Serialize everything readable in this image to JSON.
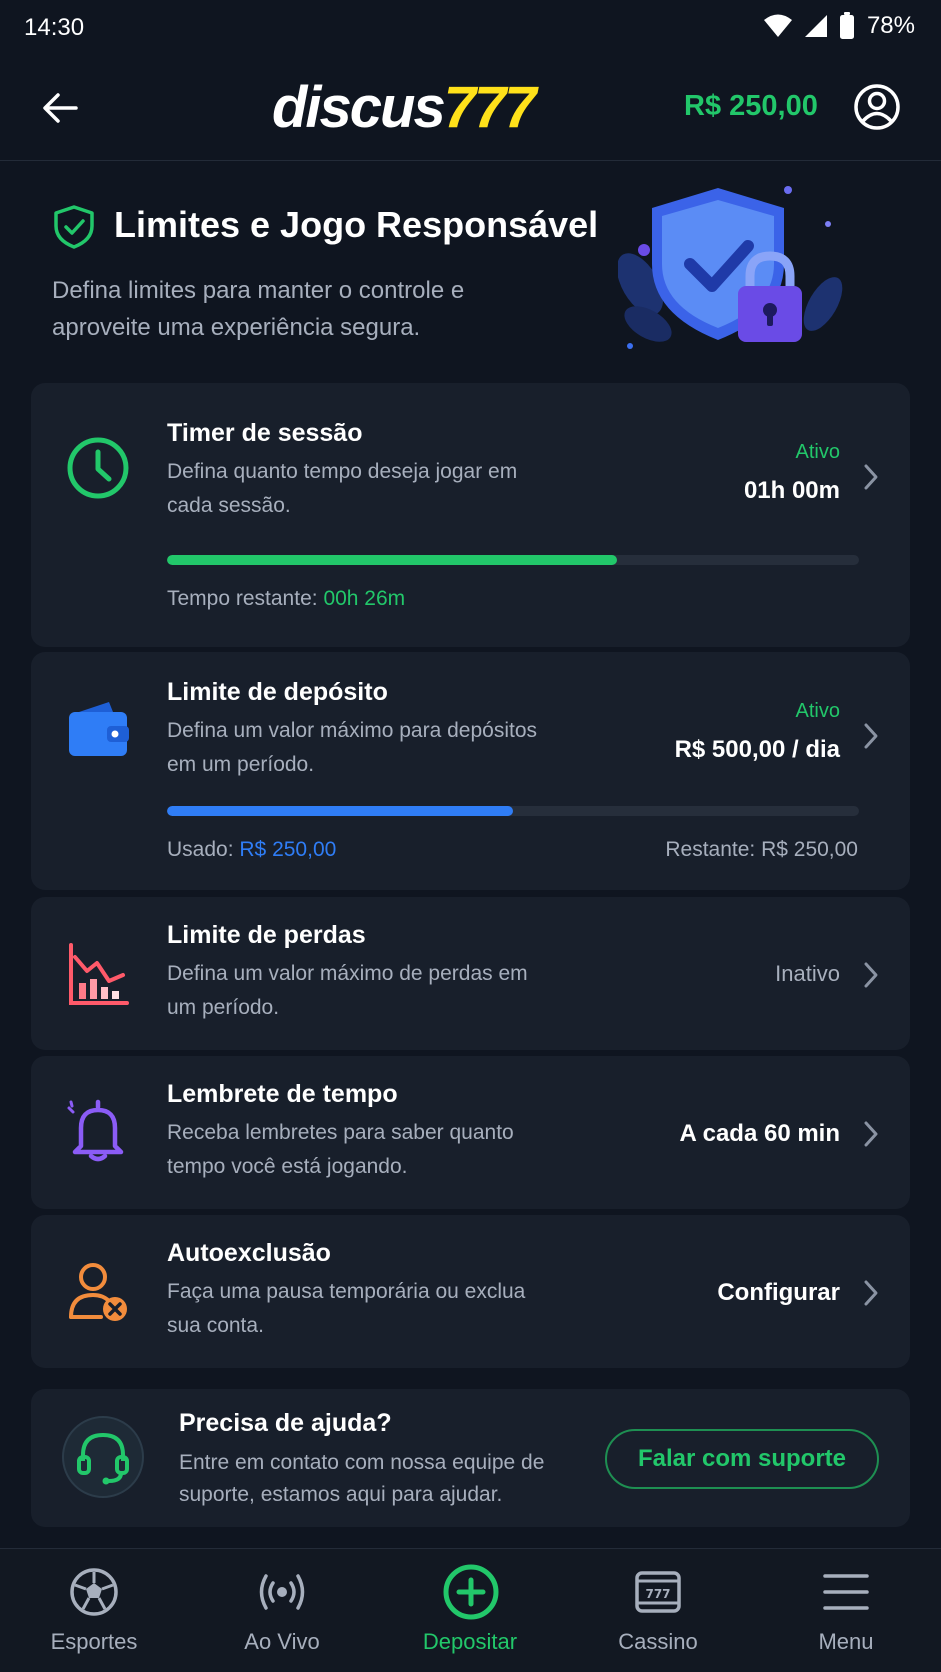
{
  "status_bar": {
    "time": "14:30",
    "battery": "78%"
  },
  "header": {
    "logo_main": "discus",
    "logo_accent": "777",
    "balance": "R$ 250,00"
  },
  "hero": {
    "title": "Limites e Jogo Responsável",
    "subtitle": "Defina limites para manter o controle e aproveite uma experiência segura."
  },
  "cards": {
    "session_timer": {
      "title": "Timer de sessão",
      "desc": "Defina quanto tempo deseja jogar em cada sessão.",
      "status": "Ativo",
      "value": "01h 00m",
      "progress": 0.65,
      "remaining_label": "Tempo restante:",
      "remaining_value": "00h 26m"
    },
    "deposit_limit": {
      "title": "Limite de depósito",
      "desc": "Defina um valor máximo para depósitos em um período.",
      "status": "Ativo",
      "value": "R$ 500,00 / dia",
      "progress": 0.5,
      "used_label": "Usado:",
      "used_value": "R$ 250,00",
      "remaining": "Restante: R$ 250,00"
    },
    "loss_limit": {
      "title": "Limite de perdas",
      "desc": "Defina um valor máximo de perdas em um período.",
      "status": "Inativo"
    },
    "time_reminder": {
      "title": "Lembrete de tempo",
      "desc": "Receba lembretes para saber quanto tempo você está jogando.",
      "value": "A cada 60 min"
    },
    "self_exclusion": {
      "title": "Autoexclusão",
      "desc": "Faça uma pausa temporária ou exclua sua conta.",
      "value": "Configurar"
    }
  },
  "help": {
    "title": "Precisa de ajuda?",
    "desc": "Entre em contato com nossa equipe de suporte, estamos aqui para ajudar.",
    "button": "Falar com suporte"
  },
  "bottom_nav": {
    "items": [
      {
        "label": "Esportes",
        "icon": "soccer-ball-icon"
      },
      {
        "label": "Ao Vivo",
        "icon": "live-broadcast-icon"
      },
      {
        "label": "Depositar",
        "icon": "plus-circle-icon"
      },
      {
        "label": "Cassino",
        "icon": "slot-machine-icon"
      },
      {
        "label": "Menu",
        "icon": "hamburger-menu-icon"
      }
    ],
    "active_index": 2
  },
  "colors": {
    "background": "#0f1520",
    "card": "#181f2b",
    "accent_green": "#22c76a",
    "accent_blue": "#2f7df6",
    "logo_yellow": "#ffe11a"
  }
}
